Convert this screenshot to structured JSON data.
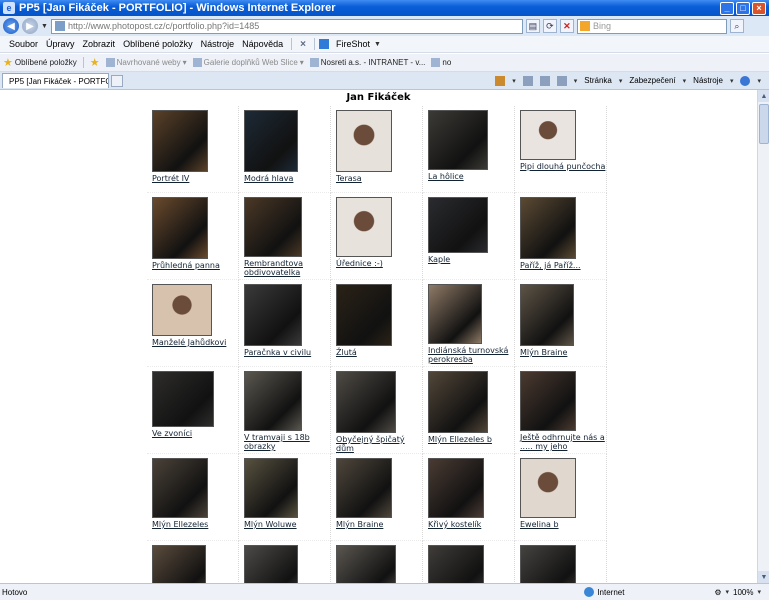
{
  "window": {
    "title": "PP5 [Jan Fikáček - PORTFOLIO] - Windows Internet Explorer",
    "app_icon": "ie-icon",
    "buttons": [
      "minimize",
      "maximize",
      "close"
    ]
  },
  "address_bar": {
    "url": "http://www.photopost.cz/c/portfolio.php?id=1485",
    "search_placeholder": "Bing"
  },
  "menu": {
    "items": [
      "Soubor",
      "Úpravy",
      "Zobrazit",
      "Oblíbené položky",
      "Nástroje",
      "Nápověda"
    ],
    "fireshot": "FireShot"
  },
  "favorites_bar": {
    "favorites_label": "Oblíbené položky",
    "items": [
      "Navrhované weby",
      "Galerie doplňků Web Slice",
      "Nosreti a.s. - INTRANET - v...",
      "no"
    ]
  },
  "tab": {
    "label": "PP5 [Jan Fikáček - PORTFOLIO]"
  },
  "command_bar": {
    "page": "Stránka",
    "security": "Zabezpečení",
    "tools": "Nástroje"
  },
  "page": {
    "title": "Jan Fikáček",
    "photos": [
      {
        "caption": "Portrét IV",
        "tone": "#5a4128"
      },
      {
        "caption": "Modrá hlava",
        "tone": "#1d2a36"
      },
      {
        "caption": "Terasa",
        "tone": "#e6e1da"
      },
      {
        "caption": "La hôlice",
        "tone": "#3b3a35"
      },
      {
        "caption": "Pipi dlouhá punčocha",
        "tone": "#e9e4df"
      },
      {
        "caption": "Průhledná panna",
        "tone": "#6a4a2d"
      },
      {
        "caption": "Rembrandtova obdivovatelka",
        "tone": "#4a3826"
      },
      {
        "caption": "Úřednice :-)",
        "tone": "#e8e2dd"
      },
      {
        "caption": "Kaple",
        "tone": "#2a2b2f"
      },
      {
        "caption": "Paříž, já Paříž...",
        "tone": "#5b4a33"
      },
      {
        "caption": "Manželé Jahůdkovi",
        "tone": "#d7c2ae"
      },
      {
        "caption": "Paračnka v civilu",
        "tone": "#3a3a3a"
      },
      {
        "caption": "Žlutá",
        "tone": "#2a2217"
      },
      {
        "caption": "Indiánská turnovská perokresba",
        "tone": "#8f7a66"
      },
      {
        "caption": "Mlýn Braine",
        "tone": "#5e5446"
      },
      {
        "caption": "Ve zvoníci",
        "tone": "#2e2d2c"
      },
      {
        "caption": "V tramvaji s 18b obrazky",
        "tone": "#5a574f"
      },
      {
        "caption": "Obyčejný špičatý dům",
        "tone": "#4f4b45"
      },
      {
        "caption": "Mlýn Ellezeles b",
        "tone": "#524638"
      },
      {
        "caption": "Ještě odhrnujte nás a ..... my jeho",
        "tone": "#4b3a30"
      },
      {
        "caption": "Mlýn Ellezeles",
        "tone": "#4a4238"
      },
      {
        "caption": "Mlýn Woluwe",
        "tone": "#57513f"
      },
      {
        "caption": "Mlýn Braine",
        "tone": "#4e463b"
      },
      {
        "caption": "Křivý kostelík",
        "tone": "#4a3b33"
      },
      {
        "caption": "Ewelina b",
        "tone": "#e0d8cf"
      },
      {
        "caption": "",
        "tone": "#5a4b3c"
      },
      {
        "caption": "",
        "tone": "#4c4a48"
      },
      {
        "caption": "",
        "tone": "#5a5650"
      },
      {
        "caption": "",
        "tone": "#3f3c39"
      },
      {
        "caption": "",
        "tone": "#454340"
      }
    ]
  },
  "status_bar": {
    "status": "Hotovo",
    "zone": "Internet",
    "zoom": "100%"
  }
}
